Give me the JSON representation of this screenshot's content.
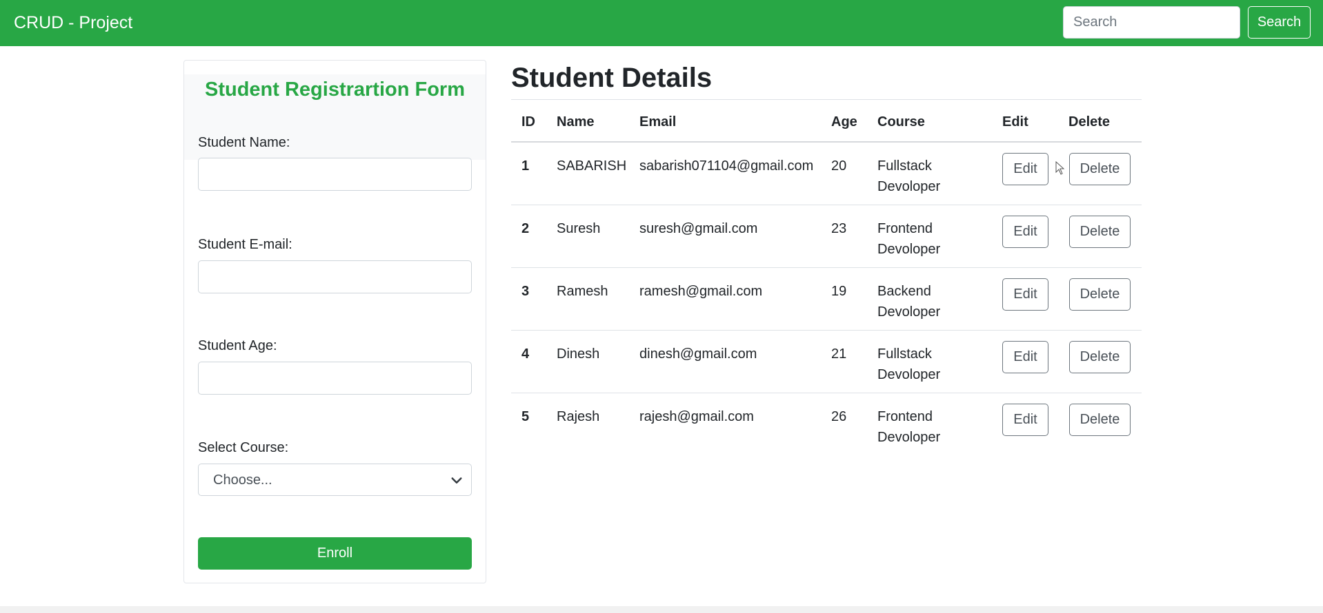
{
  "navbar": {
    "brand": "CRUD - Project",
    "search_placeholder": "Search",
    "search_button": "Search"
  },
  "form": {
    "title": "Student Registrartion Form",
    "name_label": "Student Name:",
    "email_label": "Student E-mail:",
    "age_label": "Student Age:",
    "course_label": "Select Course:",
    "course_selected": "Choose...",
    "enroll_button": "Enroll"
  },
  "table": {
    "title": "Student Details",
    "headers": [
      "ID",
      "Name",
      "Email",
      "Age",
      "Course",
      "Edit",
      "Delete"
    ],
    "rows": [
      {
        "id": "1",
        "name": "SABARISH",
        "email": "sabarish071104@gmail.com",
        "age": "20",
        "course": "Fullstack Devoloper",
        "edit": "Edit",
        "delete": "Delete"
      },
      {
        "id": "2",
        "name": "Suresh",
        "email": "suresh@gmail.com",
        "age": "23",
        "course": "Frontend Devoloper",
        "edit": "Edit",
        "delete": "Delete"
      },
      {
        "id": "3",
        "name": "Ramesh",
        "email": "ramesh@gmail.com",
        "age": "19",
        "course": "Backend Devoloper",
        "edit": "Edit",
        "delete": "Delete"
      },
      {
        "id": "4",
        "name": "Dinesh",
        "email": "dinesh@gmail.com",
        "age": "21",
        "course": "Fullstack Devoloper",
        "edit": "Edit",
        "delete": "Delete"
      },
      {
        "id": "5",
        "name": "Rajesh",
        "email": "rajesh@gmail.com",
        "age": "26",
        "course": "Frontend Devoloper",
        "edit": "Edit",
        "delete": "Delete"
      }
    ]
  },
  "colors": {
    "brand_green": "#28a745",
    "border_gray": "#6c757d"
  }
}
